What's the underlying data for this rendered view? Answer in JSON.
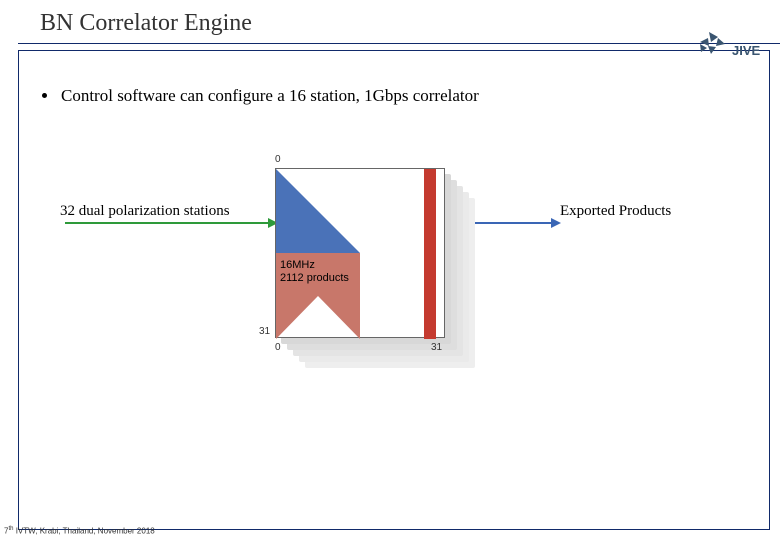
{
  "title": "BN Correlator Engine",
  "bullet": "Control software can configure a 16 station, 1Gbps correlator",
  "diagram": {
    "top_left_axis": "0",
    "left_bottom_axis": "31",
    "bottom_left_axis": "0",
    "bottom_right_axis": "31",
    "center_label_line1": "16MHz",
    "center_label_line2": "2112 products"
  },
  "left_caption": "32 dual polarization stations",
  "right_caption": "Exported Products",
  "footer_prefix": "7",
  "footer_sup": "th",
  "footer_rest": " IVTW, Krabi, Thailand, November 2018",
  "logo_text": "JIVE",
  "colors": {
    "rule": "#112a6a",
    "tri_blue": "#4a72b8",
    "tri_red": "#c8776a",
    "red_bar": "#c43a2f",
    "arrow_green": "#2e9a3a",
    "arrow_blue": "#3a66b5"
  }
}
